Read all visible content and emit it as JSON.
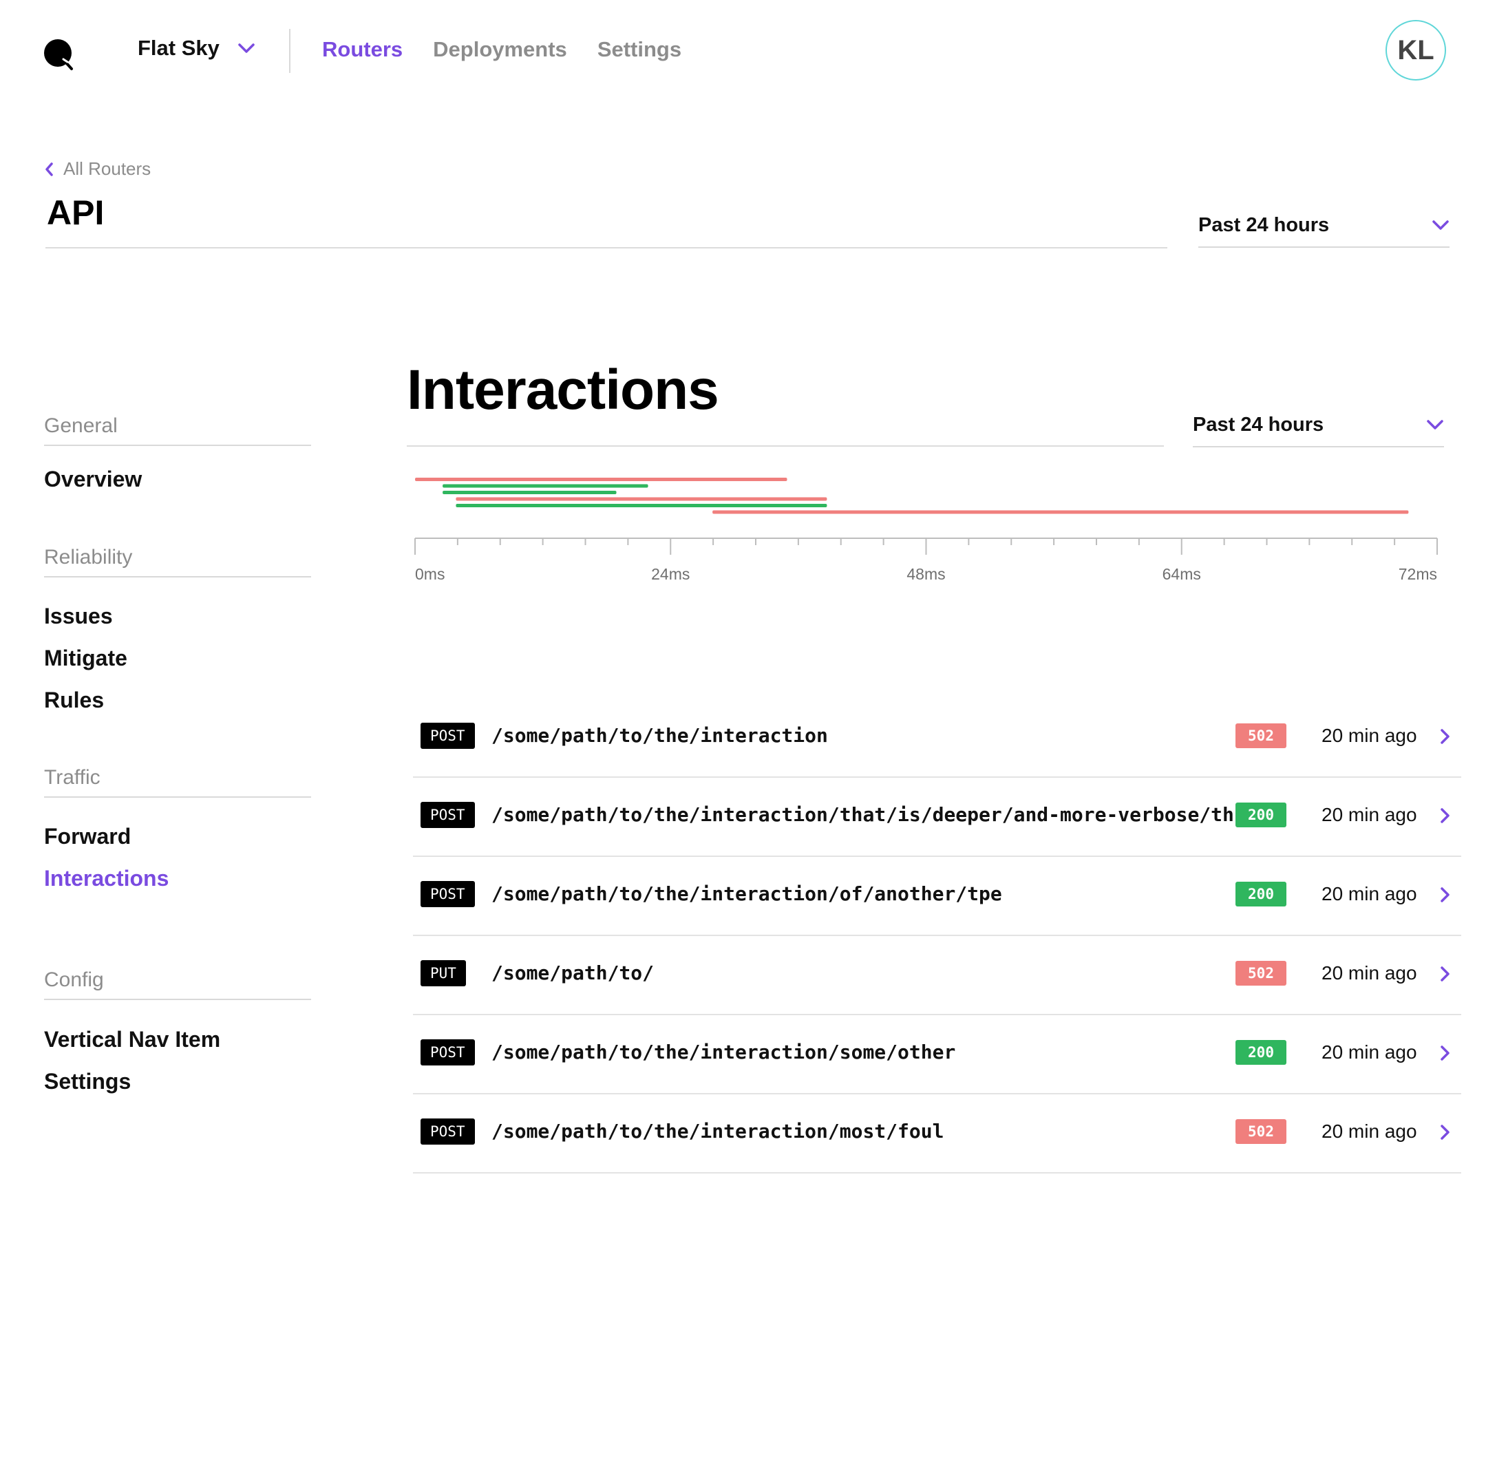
{
  "header": {
    "logo_icon": "search-lens-icon",
    "org_name": "Flat Sky",
    "nav": [
      {
        "label": "Routers",
        "active": true
      },
      {
        "label": "Deployments",
        "active": false
      },
      {
        "label": "Settings",
        "active": false
      }
    ],
    "avatar_initials": "KL"
  },
  "page": {
    "back_label": "All Routers",
    "title": "API",
    "time_range": "Past 24 hours"
  },
  "sidebar": {
    "sections": [
      {
        "title": "General",
        "items": [
          {
            "label": "Overview",
            "active": false
          }
        ]
      },
      {
        "title": "Reliability",
        "items": [
          {
            "label": "Issues",
            "active": false
          },
          {
            "label": "Mitigate",
            "active": false
          },
          {
            "label": "Rules",
            "active": false
          }
        ]
      },
      {
        "title": "Traffic",
        "items": [
          {
            "label": "Forward",
            "active": false
          },
          {
            "label": "Interactions",
            "active": true
          }
        ]
      },
      {
        "title": "Config",
        "items": [
          {
            "label": "Vertical Nav Item",
            "active": false
          },
          {
            "label": "Settings",
            "active": false
          }
        ]
      }
    ]
  },
  "interactions": {
    "title": "Interactions",
    "time_range": "Past 24 hours",
    "rows": [
      {
        "method": "POST",
        "path": "/some/path/to/the/interaction",
        "status": "502",
        "ok": false,
        "time": "20 min ago"
      },
      {
        "method": "POST",
        "path": "/some/path/to/the/interaction/that/is/deeper/and-more-verbose/th..",
        "status": "200",
        "ok": true,
        "time": "20 min ago"
      },
      {
        "method": "POST",
        "path": "/some/path/to/the/interaction/of/another/tpe",
        "status": "200",
        "ok": true,
        "time": "20 min ago"
      },
      {
        "method": "PUT",
        "path": "/some/path/to/",
        "status": "502",
        "ok": false,
        "time": "20 min ago"
      },
      {
        "method": "POST",
        "path": "/some/path/to/the/interaction/some/other",
        "status": "200",
        "ok": true,
        "time": "20 min ago"
      },
      {
        "method": "POST",
        "path": "/some/path/to/the/interaction/most/foul",
        "status": "502",
        "ok": false,
        "time": "20 min ago"
      }
    ]
  },
  "colors": {
    "accent": "#7a4be0",
    "error": "#f07f7d",
    "success": "#2fb65e",
    "avatar_ring": "#5fd6d8"
  },
  "chart_data": {
    "type": "timeline",
    "x_ticks": [
      "0ms",
      "24ms",
      "48ms",
      "64ms",
      "72ms"
    ],
    "spans": [
      {
        "start": 0,
        "end": 0.364,
        "status": "error"
      },
      {
        "start": 0.027,
        "end": 0.228,
        "status": "ok"
      },
      {
        "start": 0.027,
        "end": 0.197,
        "status": "ok"
      },
      {
        "start": 0.04,
        "end": 0.403,
        "status": "error"
      },
      {
        "start": 0.04,
        "end": 0.403,
        "status": "ok"
      },
      {
        "start": 0.291,
        "end": 0.972,
        "status": "error"
      }
    ]
  }
}
